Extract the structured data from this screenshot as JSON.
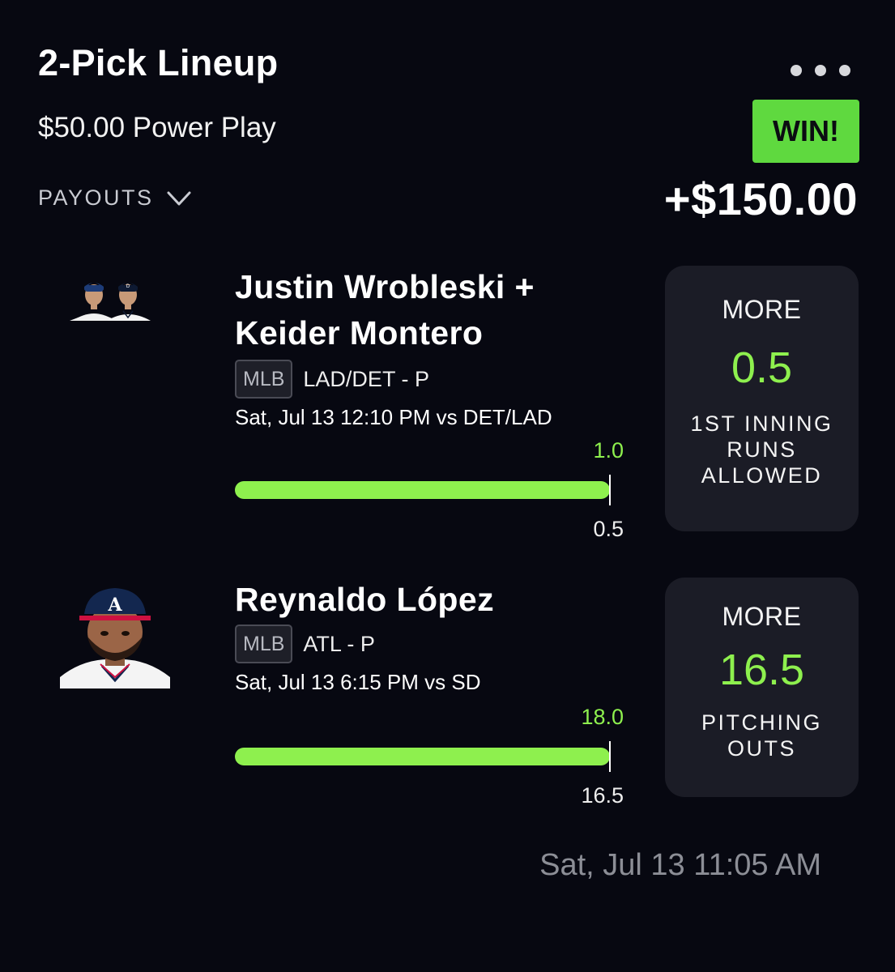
{
  "header": {
    "title": "2-Pick Lineup",
    "subtitle": "$50.00 Power Play",
    "status_badge": "WIN!",
    "payout_amount": "+$150.00",
    "payouts_label": "PAYOUTS",
    "menu_icon": "more-horizontal-icon",
    "payouts_icon": "chevron-down-icon"
  },
  "picks": [
    {
      "player_name_line1": "Justin Wrobleski +",
      "player_name_line2": "Keider Montero",
      "league": "MLB",
      "team_position": "LAD/DET - P",
      "game_time": "Sat, Jul 13 12:10 PM  vs DET/LAD",
      "actual_value": "1.0",
      "line_value": "0.5",
      "progress": 1.0,
      "direction": "MORE",
      "projection": "0.5",
      "stat_line1": "1ST INNING",
      "stat_line2": "RUNS",
      "stat_line3": "ALLOWED"
    },
    {
      "player_name_line1": "Reynaldo López",
      "league": "MLB",
      "team_position": "ATL - P",
      "game_time": "Sat, Jul 13 6:15 PM  vs SD",
      "actual_value": "18.0",
      "line_value": "16.5",
      "progress": 1.0,
      "direction": "MORE",
      "projection": "16.5",
      "stat_line1": "PITCHING",
      "stat_line2": "OUTS"
    }
  ],
  "footer": {
    "timestamp": "Sat, Jul 13 11:05 AM"
  },
  "colors": {
    "background": "#070811",
    "accent_green": "#8ef04e",
    "win_badge": "#5fd93f",
    "card": "#1b1c26"
  }
}
